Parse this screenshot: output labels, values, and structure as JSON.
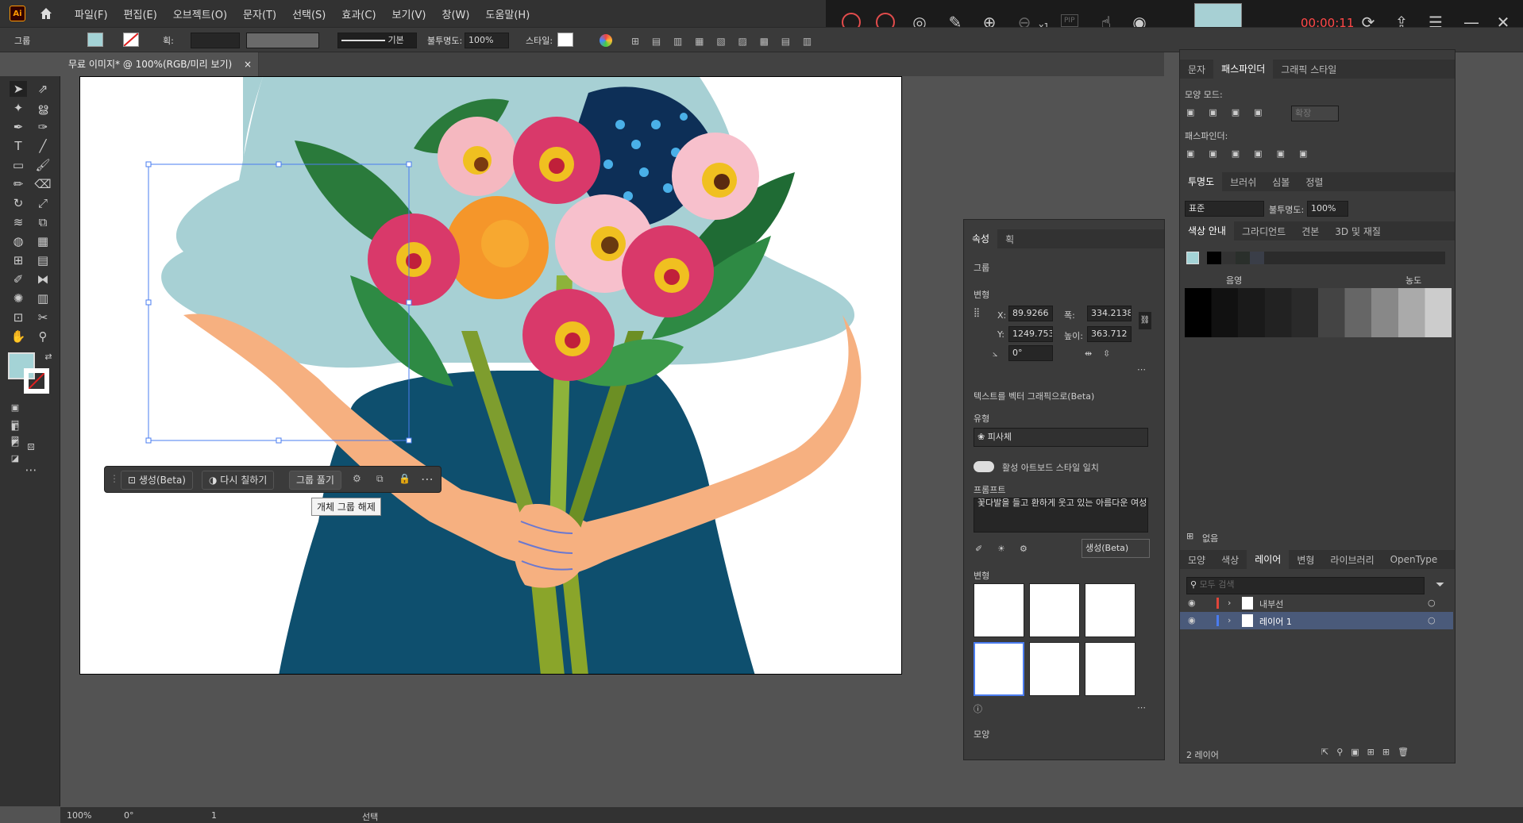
{
  "app": {
    "logo": "Ai",
    "home_icon": "home-icon"
  },
  "menu": [
    "파일(F)",
    "편집(E)",
    "오브젝트(O)",
    "문자(T)",
    "선택(S)",
    "효과(C)",
    "보기(V)",
    "창(W)",
    "도움말(H)"
  ],
  "control_bar": {
    "selection_label": "그룹",
    "stroke_label": "획:",
    "stroke_style": "기본",
    "opacity_label": "불투명도:",
    "opacity_value": "100%",
    "style_label": "스타일:"
  },
  "recorder": {
    "timer": "00:00:11",
    "zoom_badge": "x1",
    "pip": "PIP"
  },
  "document_tab": {
    "title": "무료 이미지* @ 100%(RGB/미리 보기)",
    "close": "×"
  },
  "context_bar": {
    "generate": "생성(Beta)",
    "recolor": "다시 칠하기",
    "ungroup": "그룹 풀기",
    "tooltip": "개체 그룹 해제"
  },
  "properties_panel": {
    "tabs": [
      "속성",
      "획"
    ],
    "selection": "그룹",
    "transform_title": "변형",
    "x_label": "X:",
    "x_value": "89.9266 p",
    "y_label": "Y:",
    "y_value": "1249.7533",
    "w_label": "폭:",
    "w_value": "334.2138",
    "h_label": "높이:",
    "h_value": "363.712 p",
    "angle_value": "0°",
    "text_to_vector_title": "텍스트를 벡터 그래픽으로(Beta)",
    "type_label": "유형",
    "type_value": "피사체",
    "style_match": "활성 아트보드 스타일 일치",
    "prompt_label": "프롬프트",
    "prompt_value": "꽃다발을 들고 환하게 웃고 있는 아름다운 여성",
    "generate_button": "생성(Beta)",
    "variations_label": "변형",
    "appearance_label": "모양"
  },
  "pathfinder_panel": {
    "tabs": [
      "문자",
      "패스파인더",
      "그래픽 스타일"
    ],
    "shape_modes": "모양 모드:",
    "expand": "확장",
    "pathfinders": "패스파인더:"
  },
  "transparency_panel": {
    "tabs": [
      "투명도",
      "브러쉬",
      "심볼",
      "정렬"
    ],
    "blend_mode": "표준",
    "opacity_label": "불투명도:",
    "opacity_value": "100%"
  },
  "color_guide_panel": {
    "tabs": [
      "색상 안내",
      "그라디언트",
      "견본",
      "3D 및 재질"
    ],
    "shades": "음영",
    "tints": "농도",
    "footer": "없음"
  },
  "layers_panel": {
    "tabs": [
      "모양",
      "색상",
      "레이어",
      "변형",
      "라이브러리",
      "OpenType"
    ],
    "search_placeholder": "모두 검색",
    "layers": [
      {
        "name": "내부선",
        "color": "#e0453a"
      },
      {
        "name": "레이어 1",
        "color": "#4a7cf0"
      }
    ],
    "count": "2 레이어"
  },
  "status_bar": {
    "zoom": "100%",
    "rotation": "0°",
    "artboard": "1",
    "tool": "선택"
  },
  "colors": {
    "fill": "#a4d3d6",
    "accent": "#4a7cf0",
    "artwork_bg": "#a7d0d4",
    "shirt": "#0e4f6e",
    "skin": "#f6b080"
  }
}
